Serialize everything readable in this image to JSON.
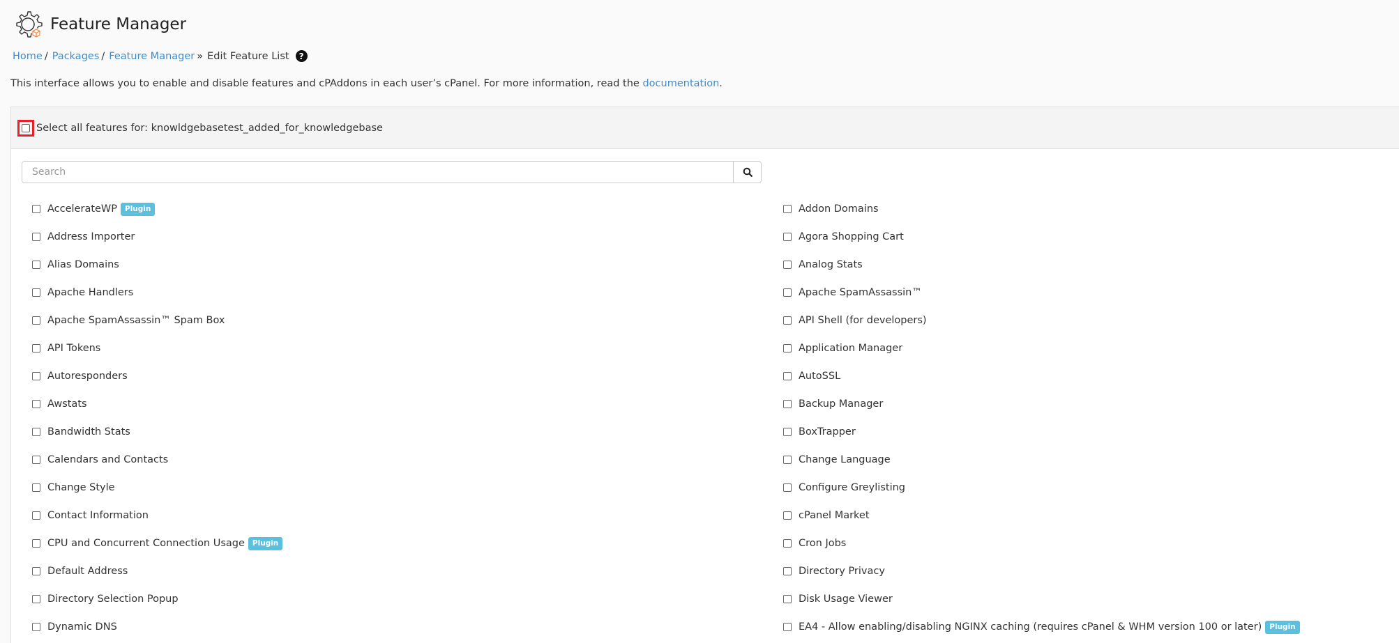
{
  "header": {
    "title": "Feature Manager",
    "logo_icon": "gear-box-icon"
  },
  "breadcrumb": {
    "items": [
      {
        "label": "Home",
        "link": true
      },
      {
        "label": "Packages",
        "link": true
      },
      {
        "label": "Feature Manager",
        "link": true
      }
    ],
    "separators": [
      "/",
      "/",
      "»"
    ],
    "current": "Edit Feature List",
    "help_icon": "?"
  },
  "description": {
    "text": "This interface allows you to enable and disable features and cPAddons in each user’s cPanel. For more information, read the ",
    "link": "documentation",
    "suffix": "."
  },
  "select_all": {
    "label": "Select all features for: knowldgebasetest_added_for_knowledgebase",
    "checked": false
  },
  "search": {
    "placeholder": "Search",
    "value": ""
  },
  "badge_label": "Plugin",
  "colors": {
    "link": "#428bca",
    "badge": "#5bc0de",
    "highlight": "#e8202a"
  },
  "features_left": [
    {
      "label": "AccelerateWP",
      "plugin": true
    },
    {
      "label": "Address Importer",
      "plugin": false
    },
    {
      "label": "Alias Domains",
      "plugin": false
    },
    {
      "label": "Apache Handlers",
      "plugin": false
    },
    {
      "label": "Apache SpamAssassin™ Spam Box",
      "plugin": false
    },
    {
      "label": "API Tokens",
      "plugin": false
    },
    {
      "label": "Autoresponders",
      "plugin": false
    },
    {
      "label": "Awstats",
      "plugin": false
    },
    {
      "label": "Bandwidth Stats",
      "plugin": false
    },
    {
      "label": "Calendars and Contacts",
      "plugin": false
    },
    {
      "label": "Change Style",
      "plugin": false
    },
    {
      "label": "Contact Information",
      "plugin": false
    },
    {
      "label": "CPU and Concurrent Connection Usage",
      "plugin": true
    },
    {
      "label": "Default Address",
      "plugin": false
    },
    {
      "label": "Directory Selection Popup",
      "plugin": false
    },
    {
      "label": "Dynamic DNS",
      "plugin": false
    }
  ],
  "features_right": [
    {
      "label": "Addon Domains",
      "plugin": false
    },
    {
      "label": "Agora Shopping Cart",
      "plugin": false
    },
    {
      "label": "Analog Stats",
      "plugin": false
    },
    {
      "label": "Apache SpamAssassin™",
      "plugin": false
    },
    {
      "label": "API Shell (for developers)",
      "plugin": false
    },
    {
      "label": "Application Manager",
      "plugin": false
    },
    {
      "label": "AutoSSL",
      "plugin": false
    },
    {
      "label": "Backup Manager",
      "plugin": false
    },
    {
      "label": "BoxTrapper",
      "plugin": false
    },
    {
      "label": "Change Language",
      "plugin": false
    },
    {
      "label": "Configure Greylisting",
      "plugin": false
    },
    {
      "label": "cPanel Market",
      "plugin": false
    },
    {
      "label": "Cron Jobs",
      "plugin": false
    },
    {
      "label": "Directory Privacy",
      "plugin": false
    },
    {
      "label": "Disk Usage Viewer",
      "plugin": false
    },
    {
      "label": "EA4 - Allow enabling/disabling NGINX caching (requires cPanel & WHM version 100 or later)",
      "plugin": true
    }
  ]
}
